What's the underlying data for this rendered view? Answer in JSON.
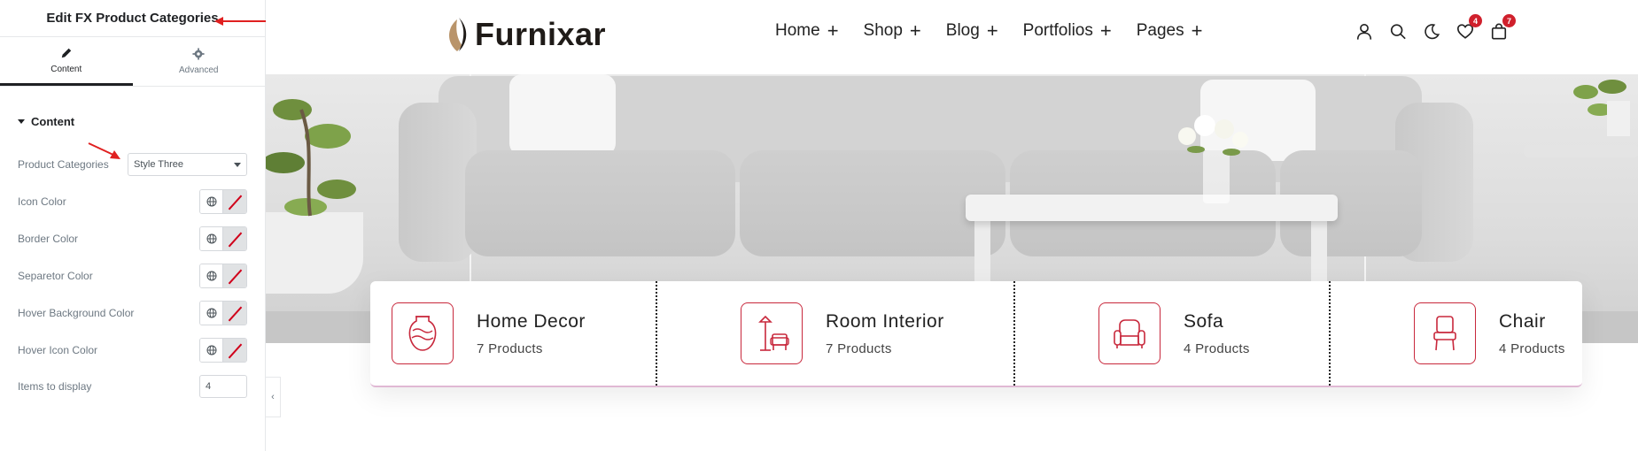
{
  "editor": {
    "title": "Edit FX Product Categories",
    "tabs": [
      {
        "label": "Content",
        "icon": "pencil-icon"
      },
      {
        "label": "Advanced",
        "icon": "gear-icon"
      }
    ],
    "section_label": "Content",
    "controls": {
      "product_categories": {
        "label": "Product Categories",
        "value": "Style Three"
      },
      "icon_color": {
        "label": "Icon Color"
      },
      "border_color": {
        "label": "Border Color"
      },
      "separator_color": {
        "label": "Separetor Color"
      },
      "hover_bg_color": {
        "label": "Hover Background Color"
      },
      "hover_icon_color": {
        "label": "Hover Icon Color"
      },
      "items_to_display": {
        "label": "Items to display",
        "value": "4"
      }
    },
    "collapse_glyph": "‹"
  },
  "site": {
    "logo": "Furnixar",
    "nav": [
      {
        "label": "Home"
      },
      {
        "label": "Shop"
      },
      {
        "label": "Blog"
      },
      {
        "label": "Portfolios"
      },
      {
        "label": "Pages"
      }
    ],
    "nav_plus": "+",
    "header_icons": [
      "user-icon",
      "search-icon",
      "moon-icon",
      "heart-icon",
      "bag-icon"
    ],
    "wishlist_count": "4",
    "cart_count": "7",
    "categories": [
      {
        "title": "Home Decor",
        "count": "7 Products",
        "icon": "vase-icon"
      },
      {
        "title": "Room Interior",
        "count": "7 Products",
        "icon": "lamp-chair-icon"
      },
      {
        "title": "Sofa",
        "count": "4 Products",
        "icon": "armchair-icon"
      },
      {
        "title": "Chair",
        "count": "4 Products",
        "icon": "chair-icon"
      }
    ]
  },
  "colors": {
    "accent": "#c8283c",
    "badge": "#d0202c",
    "annotation": "#e02020"
  }
}
